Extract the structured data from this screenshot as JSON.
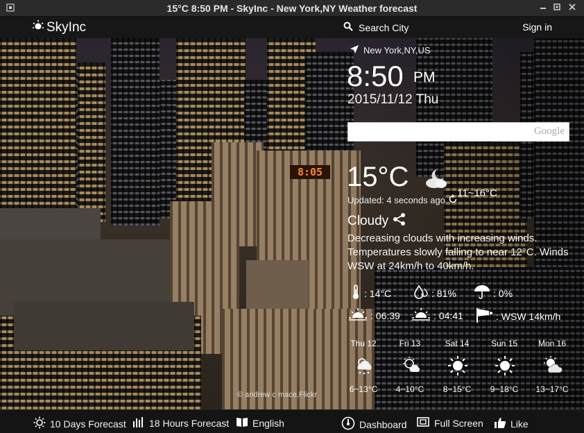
{
  "window": {
    "title": "15°C 8:50 PM - SkyInc - New York,NY Weather forecast"
  },
  "topbar": {
    "brand": "SkyInc",
    "search_label": "Search City",
    "signin_label": "Sign in"
  },
  "weather": {
    "location": "New York,NY,US",
    "time": "8:50",
    "ampm": "PM",
    "date": "2015/11/12 Thu",
    "search": {
      "value": "",
      "logo_text": "Google"
    },
    "temperature": "15°C",
    "updated": "Updated: 4 seconds ago",
    "range": "11~16°C",
    "condition": "Cloudy",
    "description": "Decreasing clouds with increasing winds. Temperatures slowly falling to near 12°C. Winds WSW at 24km/h to 40km/h.",
    "stats": {
      "feels_like": ": 14°C",
      "humidity": ": 81%",
      "precipitation": ": 0%",
      "sunrise": ": 06:39",
      "sunset": ": 04:41",
      "wind": ": WSW 14km/h"
    },
    "forecast": [
      {
        "day": "Thu 12",
        "range": "6~13°C",
        "icon": "snow-cloud-icon"
      },
      {
        "day": "Fri 13",
        "range": "4~10°C",
        "icon": "partly-sunny-rain-icon"
      },
      {
        "day": "Sat 14",
        "range": "8~15°C",
        "icon": "sun-icon"
      },
      {
        "day": "Sun 15",
        "range": "9~18°C",
        "icon": "sun-icon"
      },
      {
        "day": "Mon 16",
        "range": "13~17°C",
        "icon": "partly-cloudy-icon"
      }
    ]
  },
  "photo_credit": "© andrew c mace,Flickr",
  "bottombar": {
    "ten_days": "10 Days Forecast",
    "hours": "18 Hours Forecast",
    "language": "English",
    "dashboard": "Dashboard",
    "fullscreen": "Full Screen",
    "like": "Like"
  },
  "colors": {
    "bar_bg": "#141414",
    "sign_orange": "#ff8a2a"
  }
}
